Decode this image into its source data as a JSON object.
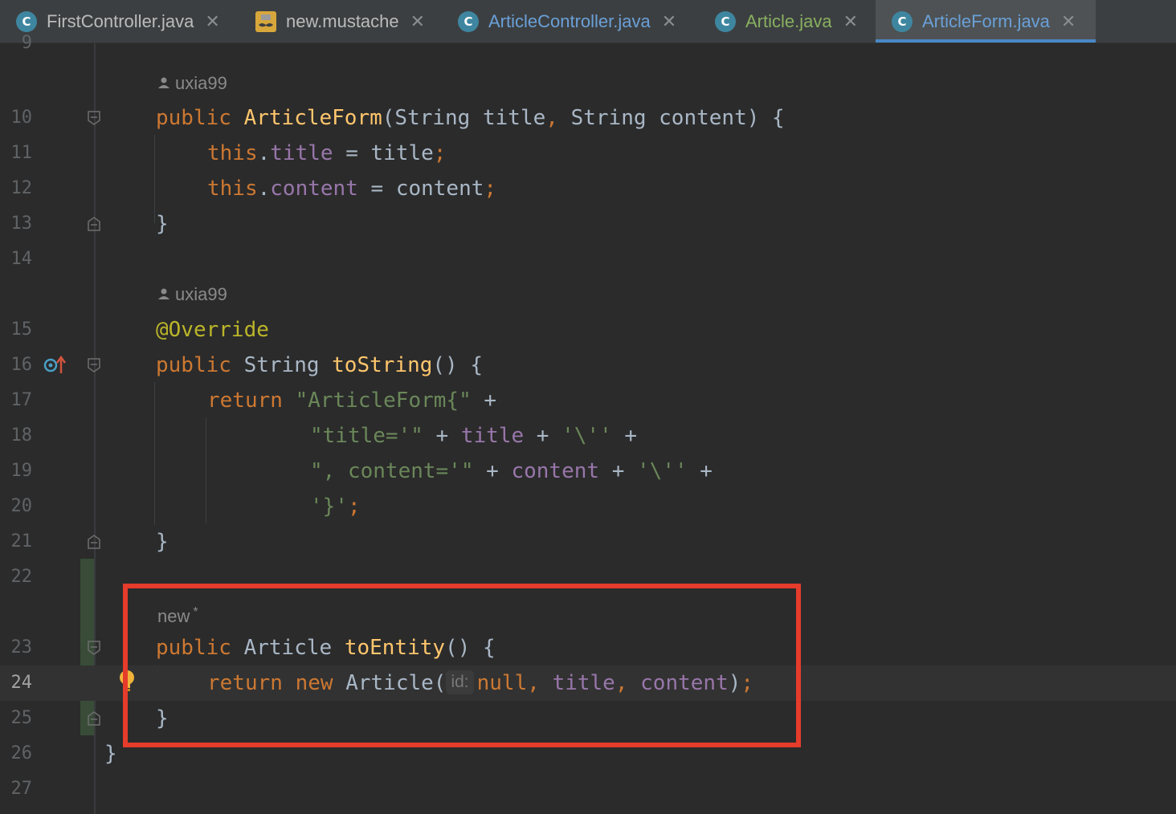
{
  "tabs": [
    {
      "label": "FirstController.java",
      "icon": "class-icon",
      "active": false
    },
    {
      "label": "new.mustache",
      "icon": "mustache-icon",
      "active": false
    },
    {
      "label": "ArticleController.java",
      "icon": "class-icon",
      "active": false
    },
    {
      "label": "Article.java",
      "icon": "class-icon",
      "active": false
    },
    {
      "label": "ArticleForm.java",
      "icon": "class-icon",
      "active": true
    }
  ],
  "tab_icon_letter": "C",
  "tab_close_glyph": "✕",
  "editor": {
    "line_numbers": [
      "9",
      "10",
      "11",
      "12",
      "13",
      "14",
      "15",
      "16",
      "17",
      "18",
      "19",
      "20",
      "21",
      "22",
      "23",
      "24",
      "25",
      "26",
      "27"
    ],
    "current_line": "24",
    "authors": {
      "constructor": "uxia99",
      "tostring": "uxia99",
      "toentity": "new"
    },
    "toentity_modified_mark": "*",
    "param_hint": "id:",
    "lines": {
      "l10": {
        "kw": "public",
        "name": "ArticleForm",
        "rest": "(String title",
        "comma": ",",
        "rest2": " String content) {"
      },
      "l11": {
        "kw": "this",
        "dot": ".",
        "field": "title",
        "rest": " = title",
        "semi": ";"
      },
      "l12": {
        "kw": "this",
        "dot": ".",
        "field": "content",
        "rest": " = content",
        "semi": ";"
      },
      "l13": {
        "text": "}"
      },
      "l15": {
        "text": "@Override"
      },
      "l16": {
        "kw": "public",
        "type": " String ",
        "name": "toString",
        "rest": "() {"
      },
      "l17": {
        "kw": "return",
        "str": "\"ArticleForm{\"",
        "op": " +"
      },
      "l18": {
        "str": "\"title='\"",
        "op1": " + ",
        "field": "title",
        "op2": " + ",
        "str2": "'\\''",
        "op3": " +"
      },
      "l19": {
        "str": "\", content='\"",
        "op1": " + ",
        "field": "content",
        "op2": " + ",
        "str2": "'\\''",
        "op3": " +"
      },
      "l20": {
        "str": "'}'",
        "semi": ";"
      },
      "l21": {
        "text": "}"
      },
      "l23": {
        "kw": "public",
        "type": " Article ",
        "name": "toEntity",
        "rest": "() {"
      },
      "l24": {
        "kw1": "return",
        "kw2": "new",
        "type": " Article(",
        "val": "null",
        "c1": ",",
        "f1": "title",
        "c2": ",",
        "f2": "content",
        "close": ")",
        "semi": ";"
      },
      "l25": {
        "text": "}"
      },
      "l26": {
        "text": "}"
      }
    }
  },
  "colors": {
    "highlight_box": "#e53c2b",
    "active_tab_underline": "#4a88c7"
  }
}
